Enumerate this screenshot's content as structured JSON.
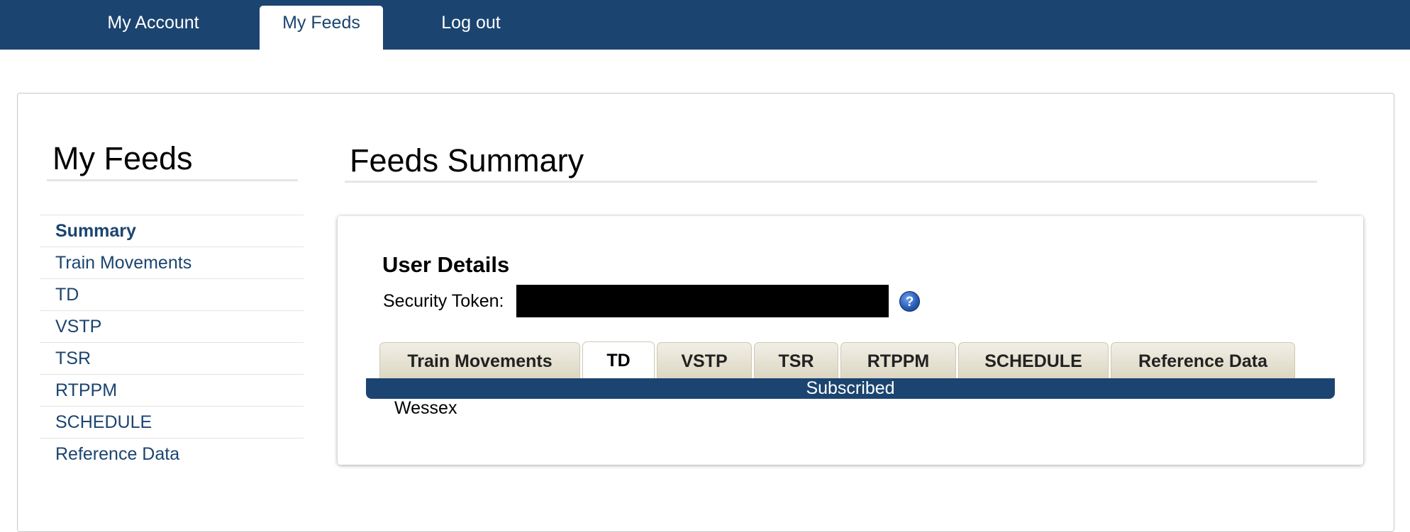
{
  "nav": {
    "items": [
      {
        "label": "My Account",
        "active": false
      },
      {
        "label": "My Feeds",
        "active": true
      },
      {
        "label": "Log out",
        "active": false
      }
    ]
  },
  "sidebar": {
    "title": "My Feeds",
    "items": [
      {
        "label": "Summary",
        "active": true
      },
      {
        "label": "Train Movements",
        "active": false
      },
      {
        "label": "TD",
        "active": false
      },
      {
        "label": "VSTP",
        "active": false
      },
      {
        "label": "TSR",
        "active": false
      },
      {
        "label": "RTPPM",
        "active": false
      },
      {
        "label": "SCHEDULE",
        "active": false
      },
      {
        "label": "Reference Data",
        "active": false
      }
    ]
  },
  "main": {
    "title": "Feeds Summary",
    "user_details": {
      "title": "User Details",
      "token_label": "Security Token:",
      "help_icon": "help-icon"
    },
    "tabs": [
      {
        "label": "Train Movements",
        "active": false
      },
      {
        "label": "TD",
        "active": true
      },
      {
        "label": "VSTP",
        "active": false
      },
      {
        "label": "TSR",
        "active": false
      },
      {
        "label": "RTPPM",
        "active": false
      },
      {
        "label": "SCHEDULE",
        "active": false
      },
      {
        "label": "Reference Data",
        "active": false
      }
    ],
    "status_bar": "Subscribed",
    "subscriptions": [
      "Wessex"
    ]
  },
  "colors": {
    "brand": "#1b4470",
    "tab_bg": "#dcd6c2"
  }
}
